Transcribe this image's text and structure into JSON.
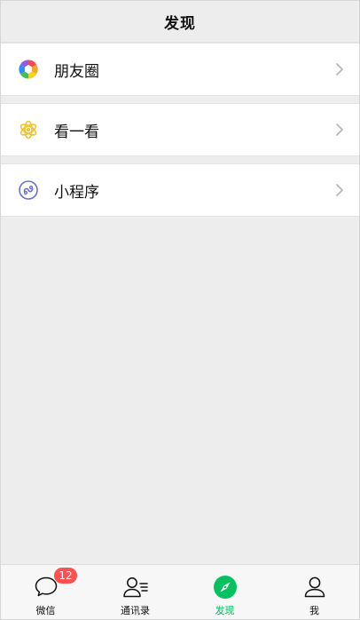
{
  "header": {
    "title": "发现"
  },
  "menu": {
    "items": [
      {
        "label": "朋友圈",
        "icon": "moments-aperture-icon"
      },
      {
        "label": "看一看",
        "icon": "top-stories-icon"
      },
      {
        "label": "小程序",
        "icon": "mini-program-icon"
      }
    ]
  },
  "tabbar": {
    "tabs": [
      {
        "label": "微信",
        "icon": "chat-bubble-icon",
        "badge": "12"
      },
      {
        "label": "通讯录",
        "icon": "contacts-icon"
      },
      {
        "label": "发现",
        "icon": "compass-icon",
        "active": true
      },
      {
        "label": "我",
        "icon": "person-icon"
      }
    ]
  },
  "colors": {
    "accent": "#07c160",
    "badge": "#fa5151",
    "background": "#ededed",
    "cell": "#ffffff"
  }
}
